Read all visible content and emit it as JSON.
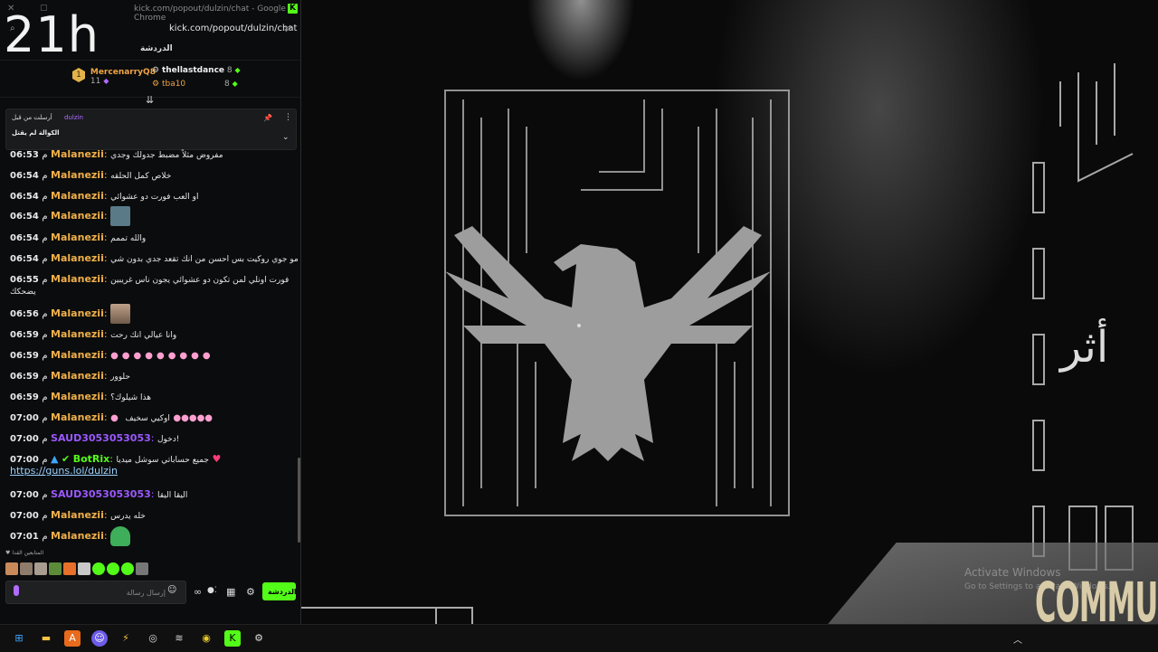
{
  "window": {
    "title": "kick.com/popout/dulzin/chat - Google Chrome",
    "url": "kick.com/popout/dulzin/chat",
    "clock_overlay": "21h"
  },
  "chat": {
    "header": "الدردشة",
    "top_gifters": [
      {
        "rank": "1",
        "name": "MercenarryQ8",
        "count": "11"
      },
      {
        "name": "thellastdance",
        "count": "8"
      },
      {
        "name": "tba10",
        "count": "8"
      }
    ],
    "pinned": {
      "pinned_by_label": "أرسلت من قبل",
      "user": "dulzin",
      "message": "الكوالة لم يقتل"
    },
    "messages": [
      {
        "time": "06:53",
        "ampm": "م",
        "user": "Malanezii",
        "text": "مفروض مثلاً مضبط جدولك وجدي"
      },
      {
        "time": "06:54",
        "ampm": "م",
        "user": "Malanezii",
        "text": "خلاص كمل الحلقه"
      },
      {
        "time": "06:54",
        "ampm": "م",
        "user": "Malanezii",
        "text": "او العب فورت دو عشوائي"
      },
      {
        "time": "06:54",
        "ampm": "م",
        "user": "Malanezii",
        "text": ""
      },
      {
        "time": "06:54",
        "ampm": "م",
        "user": "Malanezii",
        "text": "والله تممم"
      },
      {
        "time": "06:54",
        "ampm": "م",
        "user": "Malanezii",
        "text": "مو جوي روكيت بس احسن من انك تقعد جدي بدون شي"
      },
      {
        "time": "06:55",
        "ampm": "م",
        "user": "Malanezii",
        "text": "فورت اونلي لمن تكون دو عشوائي يجون ناس غريبين",
        "text2": "يضحكك"
      },
      {
        "time": "06:56",
        "ampm": "م",
        "user": "Malanezii",
        "text": ""
      },
      {
        "time": "06:59",
        "ampm": "م",
        "user": "Malanezii",
        "text": "وانا عيالي انك رحت"
      },
      {
        "time": "06:59",
        "ampm": "م",
        "user": "Malanezii",
        "text": ""
      },
      {
        "time": "06:59",
        "ampm": "م",
        "user": "Malanezii",
        "text": "حلوور"
      },
      {
        "time": "06:59",
        "ampm": "م",
        "user": "Malanezii",
        "text": "هذا شيلوك؟"
      },
      {
        "time": "07:00",
        "ampm": "م",
        "user": "Malanezii",
        "text": "اوكيي سخيف"
      },
      {
        "time": "07:00",
        "ampm": "م",
        "user": "SAUD3053053053",
        "text": "دخول!"
      },
      {
        "time": "07:00",
        "ampm": "م",
        "user": "BotRix",
        "text": "جميع حساباتي سوشل ميديا",
        "link": "https://guns.lol/dulzin"
      },
      {
        "time": "07:00",
        "ampm": "م",
        "user": "SAUD3053053053",
        "text": "اليقا اليقا"
      },
      {
        "time": "07:00",
        "ampm": "م",
        "user": "Malanezii",
        "text": "خله يدرس"
      },
      {
        "time": "07:01",
        "ampm": "م",
        "user": "Malanezii",
        "text": ""
      }
    ],
    "supporters_label": "المتابعين القدا",
    "input_placeholder": "إرسال رسالة",
    "send_label": "الدردشة"
  },
  "stream": {
    "activate_title": "Activate Windows",
    "activate_sub": "Go to Settings to activate Windows.",
    "community_text": "COMMUNITY"
  },
  "colors": {
    "kick_green": "#53fc18",
    "username_orange": "#f0b04a",
    "username_purple": "#9b59ff"
  }
}
